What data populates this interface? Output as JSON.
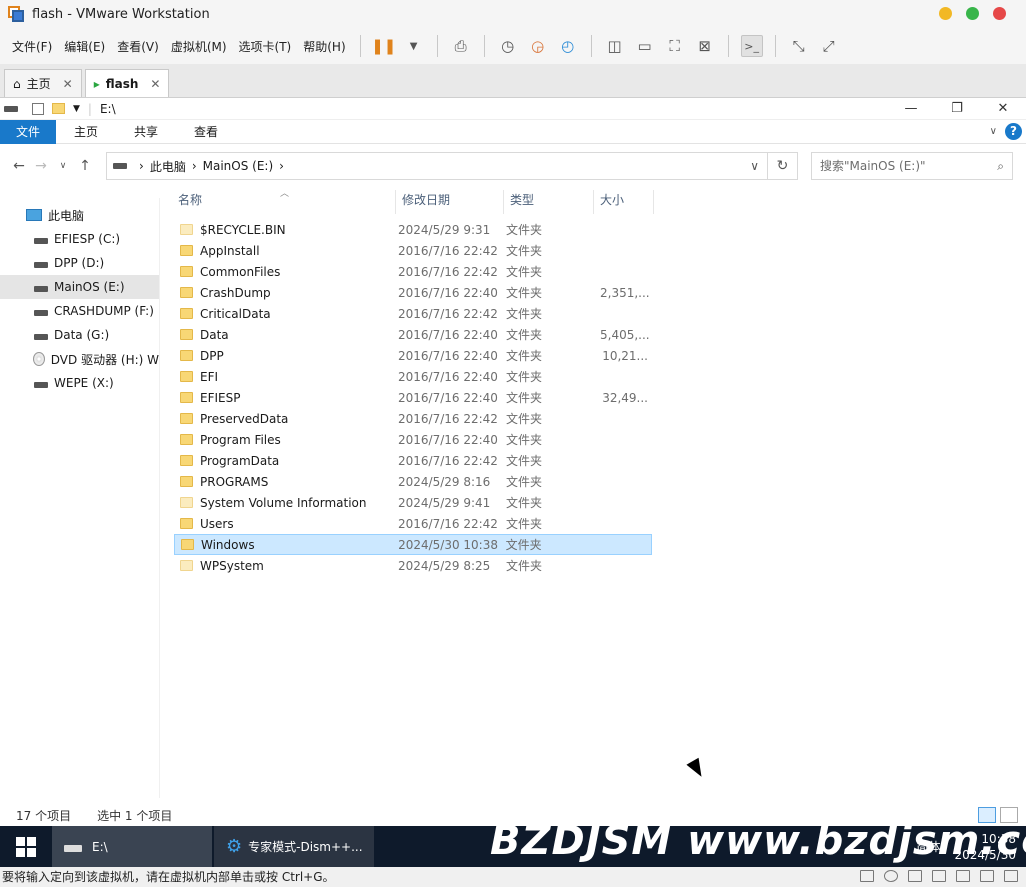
{
  "window": {
    "title": "flash - VMware Workstation"
  },
  "vm_menu": [
    "文件(F)",
    "编辑(E)",
    "查看(V)",
    "虚拟机(M)",
    "选项卡(T)",
    "帮助(H)"
  ],
  "vm_tabs": [
    {
      "label": "主页"
    },
    {
      "label": "flash"
    }
  ],
  "explorer": {
    "title_path": "E:\\",
    "ribbon_tabs": [
      "文件",
      "主页",
      "共享",
      "查看"
    ],
    "breadcrumb": [
      "此电脑",
      "MainOS (E:)"
    ],
    "search_placeholder": "搜索\"MainOS (E:)\"",
    "sidebar": [
      {
        "label": "此电脑",
        "kind": "pc",
        "indent": 0
      },
      {
        "label": "EFIESP (C:)",
        "kind": "drive",
        "indent": 1
      },
      {
        "label": "DPP (D:)",
        "kind": "drive",
        "indent": 1
      },
      {
        "label": "MainOS (E:)",
        "kind": "drive",
        "indent": 1,
        "selected": true
      },
      {
        "label": "CRASHDUMP (F:)",
        "kind": "drive",
        "indent": 1
      },
      {
        "label": "Data (G:)",
        "kind": "drive",
        "indent": 1
      },
      {
        "label": "DVD 驱动器 (H:) W",
        "kind": "dvd",
        "indent": 1
      },
      {
        "label": "WEPE (X:)",
        "kind": "drive",
        "indent": 1
      }
    ],
    "columns": [
      "名称",
      "修改日期",
      "类型",
      "大小"
    ],
    "files": [
      {
        "name": "$RECYCLE.BIN",
        "date": "2024/5/29 9:31",
        "type": "文件夹",
        "size": "",
        "light": true
      },
      {
        "name": "AppInstall",
        "date": "2016/7/16 22:42",
        "type": "文件夹",
        "size": ""
      },
      {
        "name": "CommonFiles",
        "date": "2016/7/16 22:42",
        "type": "文件夹",
        "size": ""
      },
      {
        "name": "CrashDump",
        "date": "2016/7/16 22:40",
        "type": "文件夹",
        "size": "2,351,..."
      },
      {
        "name": "CriticalData",
        "date": "2016/7/16 22:42",
        "type": "文件夹",
        "size": ""
      },
      {
        "name": "Data",
        "date": "2016/7/16 22:40",
        "type": "文件夹",
        "size": "5,405,..."
      },
      {
        "name": "DPP",
        "date": "2016/7/16 22:40",
        "type": "文件夹",
        "size": "10,21..."
      },
      {
        "name": "EFI",
        "date": "2016/7/16 22:40",
        "type": "文件夹",
        "size": ""
      },
      {
        "name": "EFIESP",
        "date": "2016/7/16 22:40",
        "type": "文件夹",
        "size": "32,49..."
      },
      {
        "name": "PreservedData",
        "date": "2016/7/16 22:42",
        "type": "文件夹",
        "size": ""
      },
      {
        "name": "Program Files",
        "date": "2016/7/16 22:40",
        "type": "文件夹",
        "size": ""
      },
      {
        "name": "ProgramData",
        "date": "2016/7/16 22:42",
        "type": "文件夹",
        "size": ""
      },
      {
        "name": "PROGRAMS",
        "date": "2024/5/29 8:16",
        "type": "文件夹",
        "size": ""
      },
      {
        "name": "System Volume Information",
        "date": "2024/5/29 9:41",
        "type": "文件夹",
        "size": "",
        "light": true
      },
      {
        "name": "Users",
        "date": "2016/7/16 22:42",
        "type": "文件夹",
        "size": ""
      },
      {
        "name": "Windows",
        "date": "2024/5/30 10:38",
        "type": "文件夹",
        "size": "",
        "selected": true
      },
      {
        "name": "WPSystem",
        "date": "2024/5/29 8:25",
        "type": "文件夹",
        "size": "",
        "light": true
      }
    ],
    "status_count": "17 个项目",
    "status_selected": "选中 1 个项目"
  },
  "taskbar": {
    "items": [
      "E:\\",
      "专家模式-Dism++..."
    ],
    "watermark": "BZDJSM www.bzdjsm.com",
    "ime": "简体",
    "time": "10:38",
    "date": "2024/5/30"
  },
  "vm_status": "要将输入定向到该虚拟机，请在虚拟机内部单击或按 Ctrl+G。",
  "colors": {
    "accent": "#1979ca",
    "selection": "#cce8ff",
    "folder": "#f8d775"
  }
}
